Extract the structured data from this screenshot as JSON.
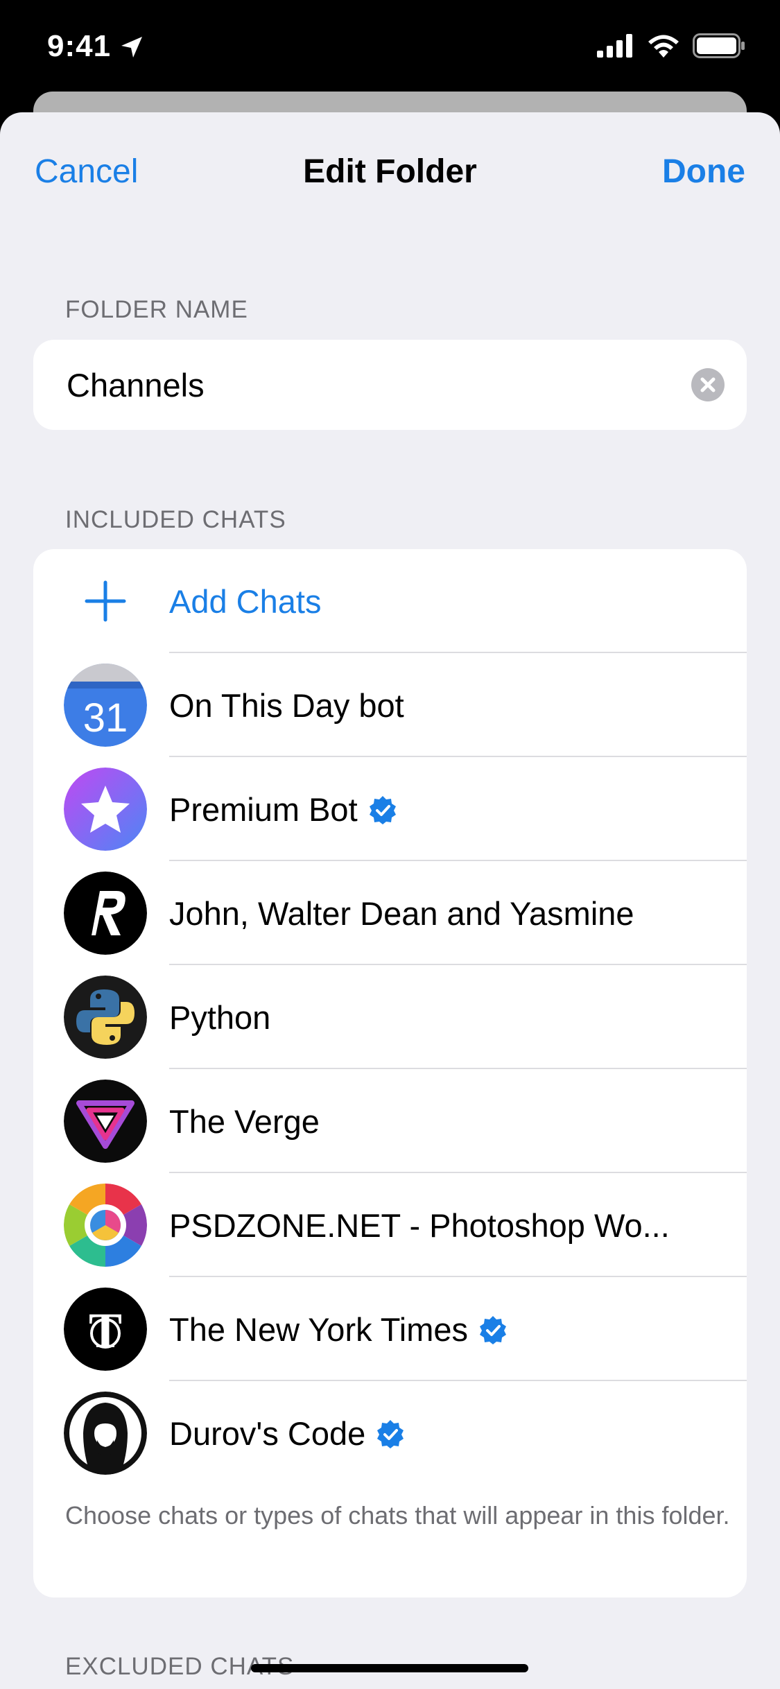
{
  "status_bar": {
    "time": "9:41"
  },
  "nav": {
    "cancel": "Cancel",
    "title": "Edit Folder",
    "done": "Done"
  },
  "folder_name": {
    "header": "FOLDER NAME",
    "value": "Channels"
  },
  "included": {
    "header": "INCLUDED CHATS",
    "add_label": "Add Chats",
    "chats": [
      {
        "name": "On This Day bot",
        "verified": false,
        "avatar": "calendar-icon"
      },
      {
        "name": "Premium Bot",
        "verified": true,
        "avatar": "star-icon"
      },
      {
        "name": "John, Walter Dean and Yasmine",
        "verified": false,
        "avatar": "r-logo"
      },
      {
        "name": "Python",
        "verified": false,
        "avatar": "python-logo"
      },
      {
        "name": "The Verge",
        "verified": false,
        "avatar": "verge-logo"
      },
      {
        "name": "PSDZONE.NET - Photoshop Wo...",
        "verified": false,
        "avatar": "color-wheel-logo"
      },
      {
        "name": "The New York Times",
        "verified": true,
        "avatar": "nyt-logo"
      },
      {
        "name": "Durov's Code",
        "verified": true,
        "avatar": "hooded-figure-logo"
      }
    ],
    "footer": "Choose chats or types of chats that will appear in this folder."
  },
  "excluded": {
    "header": "EXCLUDED CHATS"
  },
  "colors": {
    "accent": "#1a7fe6",
    "background": "#efeff4",
    "verified": "#1a7fe6"
  }
}
